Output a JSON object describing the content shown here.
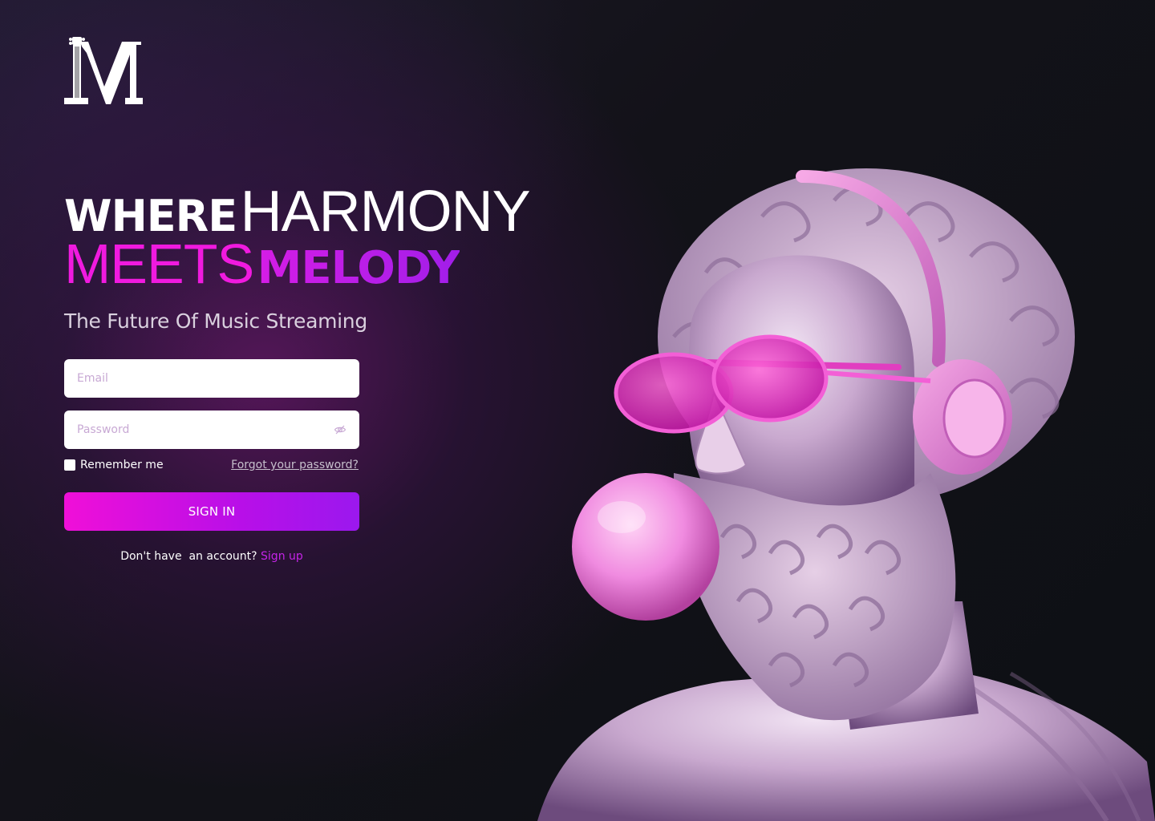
{
  "brand": {
    "logo_letter": "M",
    "logo_icon": "guitar-m-logo-icon"
  },
  "hero": {
    "line1_bold": "WHERE",
    "line1_thin": "HARMONY",
    "line2_thin": "MEETS",
    "line2_bold": "MELODY",
    "subtitle": "The Future Of Music Streaming"
  },
  "form": {
    "email_placeholder": "Email",
    "email_value": "",
    "password_placeholder": "Password",
    "password_value": "",
    "password_toggle_icon": "eye-off-icon",
    "remember_label": "Remember me",
    "remember_checked": false,
    "forgot_label": "Forgot your password?",
    "signin_label": "SIGN IN",
    "signup_prompt": "Don't have  an account? ",
    "signup_link": "Sign up"
  },
  "illustration": {
    "icon": "statue-headphones-bubblegum-illustration"
  },
  "colors": {
    "accent_pink": "#f01adf",
    "accent_purple": "#a11ee9",
    "background": "#0d1014",
    "link": "#c524e8"
  }
}
